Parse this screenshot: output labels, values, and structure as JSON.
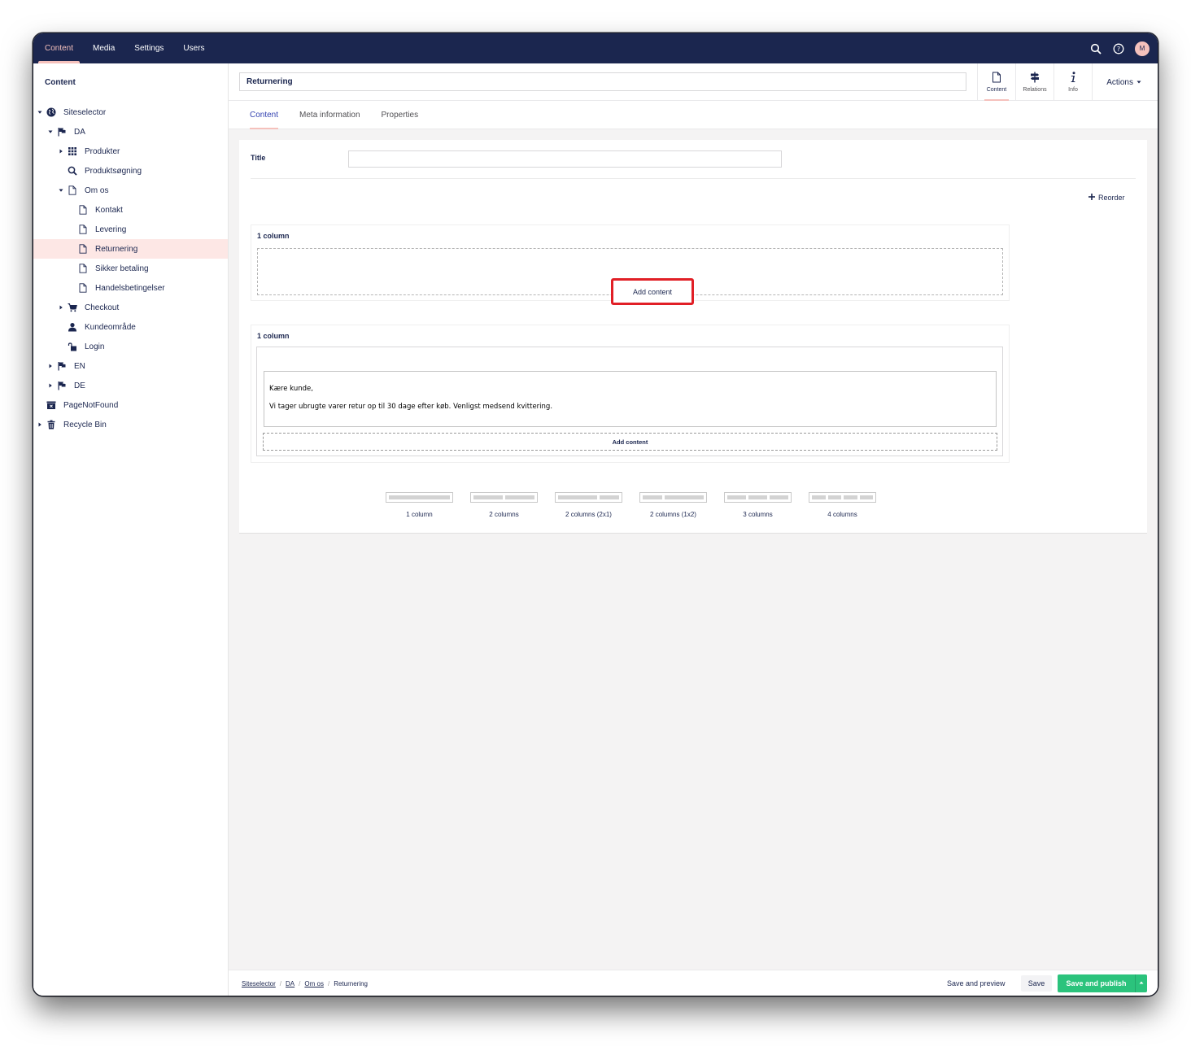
{
  "topnav": {
    "items": [
      "Content",
      "Media",
      "Settings",
      "Users"
    ],
    "active": "Content"
  },
  "user": {
    "initial": "M"
  },
  "sidebar": {
    "title": "Content",
    "tree": [
      {
        "label": "Siteselector",
        "icon": "globe-icon",
        "caret": "down",
        "indent": 0
      },
      {
        "label": "DA",
        "icon": "flag-icon",
        "caret": "down",
        "indent": 1
      },
      {
        "label": "Produkter",
        "icon": "grid-icon",
        "caret": "right",
        "indent": 2
      },
      {
        "label": "Produktsøgning",
        "icon": "search-icon",
        "caret": "",
        "indent": 2
      },
      {
        "label": "Om os",
        "icon": "document-icon",
        "caret": "down",
        "indent": 2
      },
      {
        "label": "Kontakt",
        "icon": "document-icon",
        "caret": "",
        "indent": 3
      },
      {
        "label": "Levering",
        "icon": "document-icon",
        "caret": "",
        "indent": 3
      },
      {
        "label": "Returnering",
        "icon": "document-icon",
        "caret": "",
        "indent": 3,
        "selected": true
      },
      {
        "label": "Sikker betaling",
        "icon": "document-icon",
        "caret": "",
        "indent": 3
      },
      {
        "label": "Handelsbetingelser",
        "icon": "document-icon",
        "caret": "",
        "indent": 3
      },
      {
        "label": "Checkout",
        "icon": "cart-icon",
        "caret": "right",
        "indent": 2
      },
      {
        "label": "Kundeområde",
        "icon": "user-icon",
        "caret": "",
        "indent": 2
      },
      {
        "label": "Login",
        "icon": "unlock-icon",
        "caret": "",
        "indent": 2
      },
      {
        "label": "EN",
        "icon": "flag-icon",
        "caret": "right",
        "indent": 1
      },
      {
        "label": "DE",
        "icon": "flag-icon",
        "caret": "right",
        "indent": 1
      },
      {
        "label": "PageNotFound",
        "icon": "page-not-found-icon",
        "caret": "",
        "indent": 0
      },
      {
        "label": "Recycle Bin",
        "icon": "trash-icon",
        "caret": "right",
        "indent": 0
      }
    ]
  },
  "editor": {
    "name_value": "Returnering",
    "apps": [
      {
        "label": "Content",
        "icon": "document-icon",
        "active": true
      },
      {
        "label": "Relations",
        "icon": "signpost-icon",
        "active": false
      },
      {
        "label": "Info",
        "icon": "info-icon",
        "active": false
      }
    ],
    "actions_label": "Actions"
  },
  "tabs": {
    "items": [
      "Content",
      "Meta information",
      "Properties"
    ],
    "active": "Content"
  },
  "content": {
    "title_label": "Title",
    "title_value": "",
    "reorder_label": "Reorder",
    "row1": {
      "label": "1 column",
      "add_content": "Add content"
    },
    "row2": {
      "label": "1 column",
      "text_line1": "Kære kunde,",
      "text_line2": "Vi tager ubrugte varer retur op til 30 dage efter køb. Venligst medsend kvittering.",
      "add_content": "Add content"
    },
    "layouts": [
      "1 column",
      "2 columns",
      "2 columns (2x1)",
      "2 columns (1x2)",
      "3 columns",
      "4 columns"
    ]
  },
  "footer": {
    "breadcrumb": [
      "Siteselector",
      "DA",
      "Om os",
      "Returnering"
    ],
    "save_preview": "Save and preview",
    "save": "Save",
    "save_publish": "Save and publish"
  },
  "colors": {
    "topbar": "#1b264f",
    "accent": "#f5c1bc",
    "publish": "#2bc37c",
    "highlight": "#e11f26"
  }
}
